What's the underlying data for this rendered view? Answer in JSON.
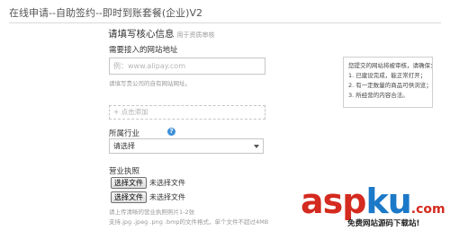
{
  "header": {
    "title": "在线申请--自助签约--即时到账套餐(企业)V2"
  },
  "form": {
    "section_title": "请填写核心信息",
    "section_subtitle": "用于资质审核",
    "url": {
      "label": "需要接入的网站地址",
      "placeholder": "例：www.alipay.com",
      "value": "",
      "hint": "请填写贵公司的自有网站网址。"
    },
    "add_link": "+ 点击添加",
    "industry": {
      "label": "所属行业",
      "help_icon": "question-circle-icon",
      "selected": "请选择"
    },
    "license": {
      "label": "营业执照",
      "files": [
        {
          "button": "选择文件",
          "status": "未选择文件"
        },
        {
          "button": "选择文件",
          "status": "未选择文件"
        }
      ],
      "hint1": "请上传清晰的营业执照照片1-2张",
      "hint2": "支持.jpg .jpeg .png .bmp的文件格式，单个文件不超过4MB"
    }
  },
  "tip": {
    "intro": "您提交的网站将被审核，请确保：",
    "items": [
      "1. 已建设完成，能正常打开；",
      "2. 有一定数量的商品可供浏览；",
      "3. 所经营的内容合法。"
    ]
  },
  "watermark": {
    "logo_part1": "asp",
    "logo_part2": "ku",
    "logo_part3": ".com",
    "caption": "免费网站源码下载站!"
  },
  "colors": {
    "accent_blue": "#3d8fd9",
    "watermark_red": "#d42a1f",
    "watermark_blue": "#1b79c8"
  }
}
